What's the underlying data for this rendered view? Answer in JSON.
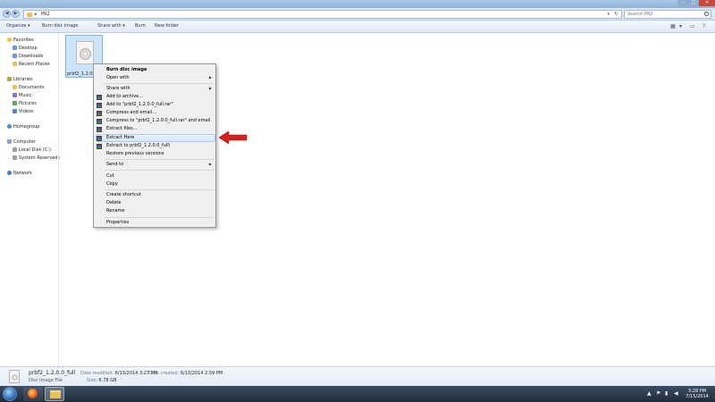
{
  "address": {
    "path_segment": "PR2",
    "arrow": "▸",
    "dropdown": "▾",
    "refresh": "↻"
  },
  "search": {
    "placeholder": "Search PR2"
  },
  "nav_buttons": {
    "back": "◀",
    "forward": "▶"
  },
  "caption": {
    "minimize": "–",
    "maximize": "□",
    "close": "✕"
  },
  "toolbar": {
    "organize": "Organize ▾",
    "burn_disc_image": "Burn disc image",
    "share_with": "Share with ▾",
    "burn": "Burn",
    "new_folder": "New folder",
    "view_icon": "▦",
    "view_drop": "▾",
    "preview_icon": "▭",
    "help_icon": "?"
  },
  "sidebar": {
    "favorites": "Favorites",
    "desktop": "Desktop",
    "downloads": "Downloads",
    "recent_places": "Recent Places",
    "libraries": "Libraries",
    "documents": "Documents",
    "music": "Music",
    "pictures": "Pictures",
    "videos": "Videos",
    "homegroup": "Homegroup",
    "computer": "Computer",
    "local_disk": "Local Disk (C:)",
    "system_reserved": "System Reserved (E:)",
    "network": "Network"
  },
  "file": {
    "label": "prbf2_1.2.0.0_full"
  },
  "context_menu": {
    "burn_disc_image": "Burn disc image",
    "open_with": "Open with",
    "share_with": "Share with",
    "add_to_archive": "Add to archive...",
    "add_to_rar": "Add to \"prbf2_1.2.0.0_full.rar\"",
    "compress_email": "Compress and email...",
    "compress_rar_email": "Compress to \"prbf2_1.2.0.0_full.rar\" and email",
    "extract_files": "Extract files...",
    "extract_here": "Extract Here",
    "extract_to": "Extract to prbf2_1.2.0.0_full\\",
    "restore_versions": "Restore previous versions",
    "send_to": "Send to",
    "cut": "Cut",
    "copy": "Copy",
    "create_shortcut": "Create shortcut",
    "delete": "Delete",
    "rename": "Rename",
    "properties": "Properties",
    "submenu_arrow": "▶"
  },
  "details": {
    "name": "prbf2_1.2.0.0_full",
    "type": "Disc Image File",
    "date_modified_label": "Date modified:",
    "date_modified": "6/13/2014 3:27 PM",
    "size_label": "Size:",
    "size": "6.78 GB",
    "date_created_label": "Date created:",
    "date_created": "6/13/2014 2:59 PM"
  },
  "taskbar": {
    "tray_up": "▲",
    "tray_flag": "⚑",
    "tray_net": "▮",
    "tray_vol": "◀",
    "time": "3:28 PM",
    "date": "7/15/2014"
  },
  "colors": {
    "highlight": "#d6e8fb",
    "arrow": "#d81e1e",
    "taskbar": "#1f2c3b"
  }
}
